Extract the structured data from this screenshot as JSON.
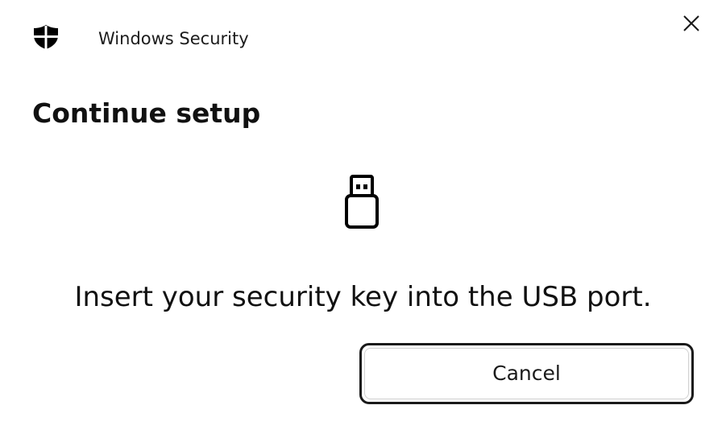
{
  "titlebar": {
    "app_title": "Windows Security",
    "app_icon": "shield-icon",
    "close_icon": "close-icon"
  },
  "main": {
    "heading": "Continue setup",
    "illustration_icon": "usb-key-icon",
    "message": "Insert your security key into the USB port."
  },
  "actions": {
    "cancel_label": "Cancel"
  },
  "colors": {
    "background": "#ffffff",
    "text": "#111111",
    "button_border": "#1a1a1a"
  }
}
